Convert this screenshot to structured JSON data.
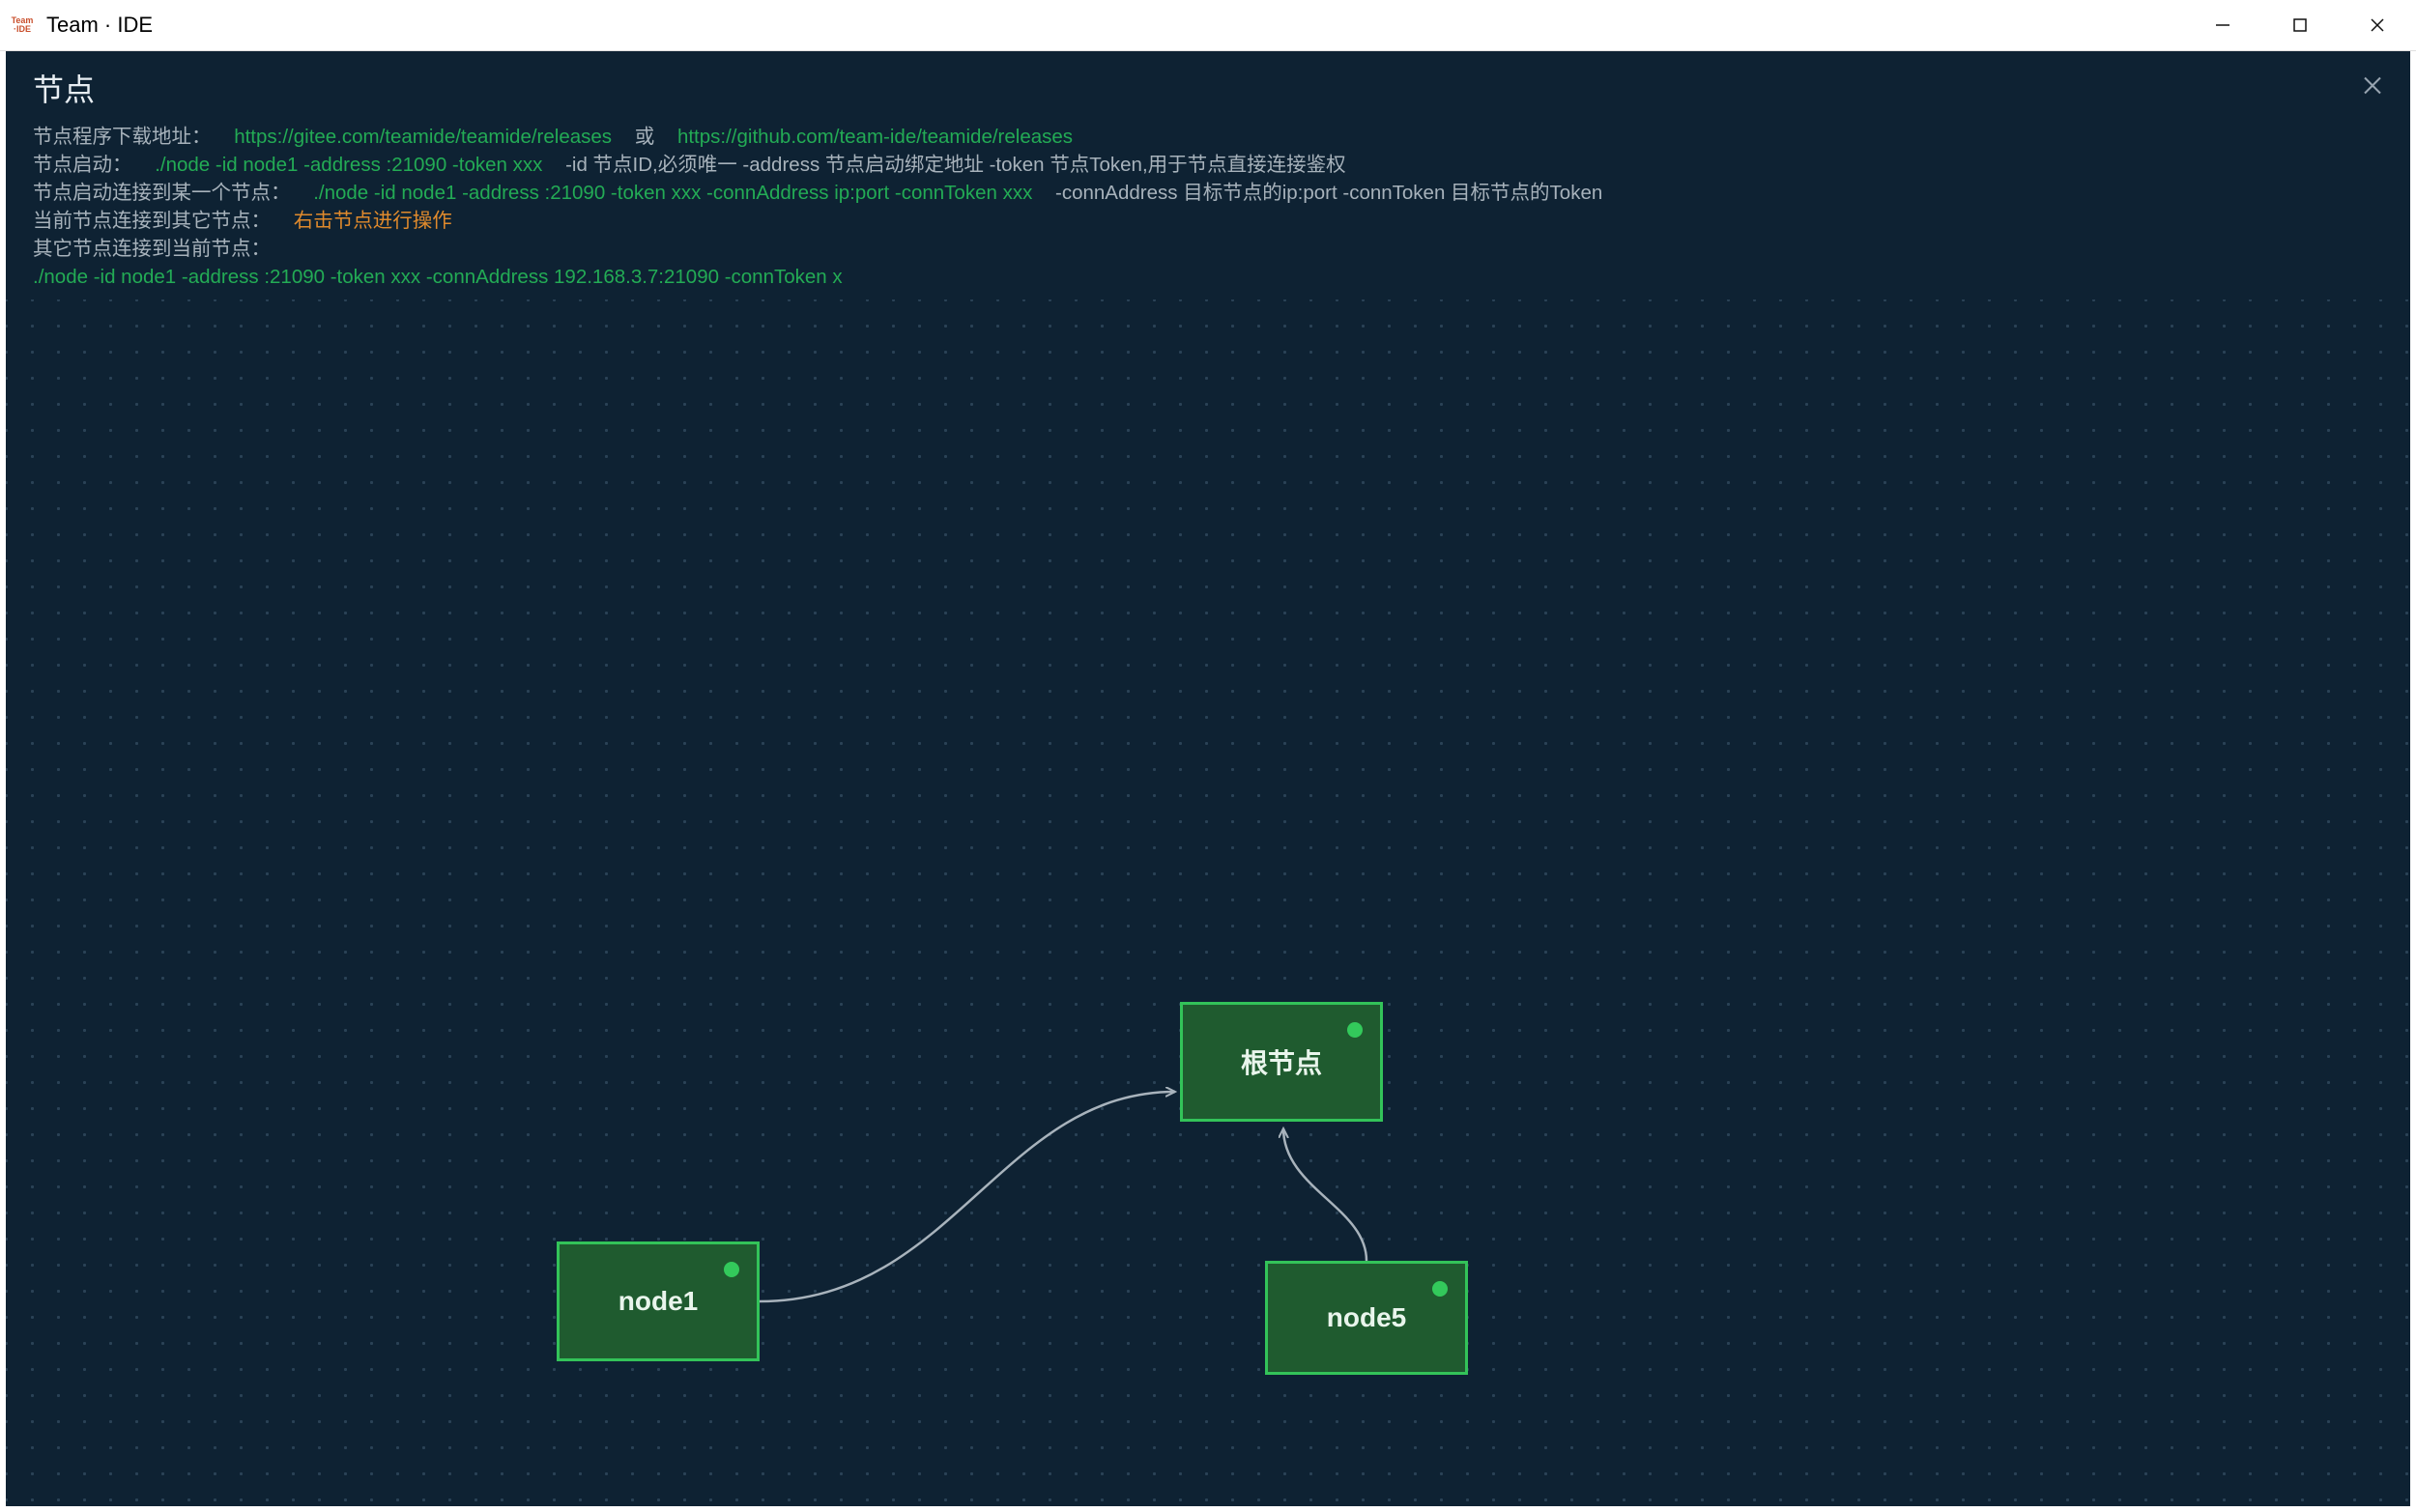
{
  "window": {
    "title": "Team · IDE",
    "logo_text": "Team · IDE"
  },
  "panel": {
    "title": "节点"
  },
  "info": {
    "row1_label": "节点程序下载地址：",
    "row1_link1": "https://gitee.com/teamide/teamide/releases",
    "row1_or": "或",
    "row1_link2": "https://github.com/team-ide/teamide/releases",
    "row2_label": "节点启动：",
    "row2_cmd": "./node -id node1 -address :21090 -token xxx",
    "row2_desc": "-id 节点ID,必须唯一 -address 节点启动绑定地址 -token 节点Token,用于节点直接连接鉴权",
    "row3_label": "节点启动连接到某一个节点：",
    "row3_cmd": "./node -id node1 -address :21090 -token xxx -connAddress ip:port -connToken xxx",
    "row3_desc": "-connAddress 目标节点的ip:port -connToken 目标节点的Token",
    "row4_label": "当前节点连接到其它节点：",
    "row4_orange": "右击节点进行操作",
    "row5_label": "其它节点连接到当前节点：",
    "row6_cmd": "./node -id node1 -address :21090 -token xxx -connAddress 192.168.3.7:21090 -connToken x"
  },
  "nodes": {
    "root": {
      "label": "根节点",
      "status": "online"
    },
    "node1": {
      "label": "node1",
      "status": "online"
    },
    "node5": {
      "label": "node5",
      "status": "online"
    }
  },
  "edges": [
    {
      "from": "node1",
      "to": "root"
    },
    {
      "from": "node5",
      "to": "root"
    }
  ]
}
